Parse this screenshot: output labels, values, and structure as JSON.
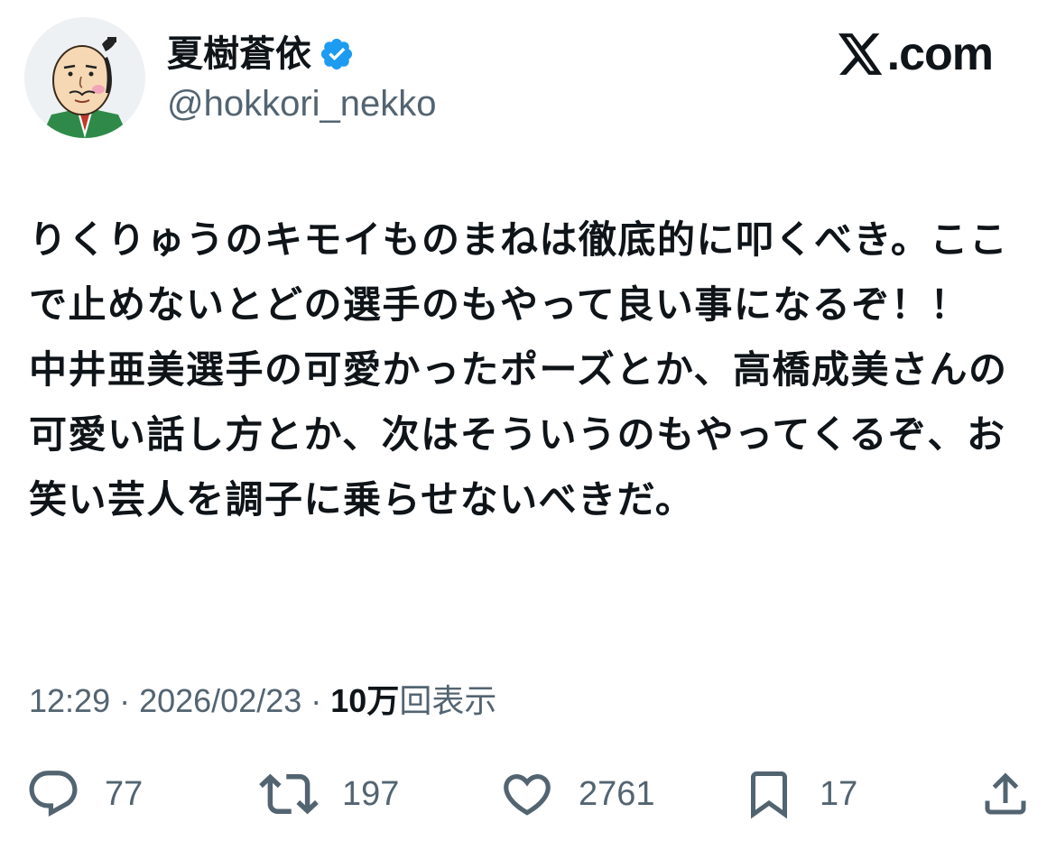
{
  "author": {
    "display_name": "夏樹蒼依",
    "handle": "@hokkori_nekko",
    "verified_icon": "verified-badge-icon",
    "verified_color": "#1d9bf0"
  },
  "brand": {
    "label": ".com",
    "icon": "x-logo-icon"
  },
  "tweet": {
    "text": "りくりゅうのキモイものまねは徹底的に叩くべき。ここで止めないとどの選手のもやって良い事になるぞ！！　中井亜美選手の可愛かったポーズとか、高橋成美さんの可愛い話し方とか、次はそういうのもやってくるぞ、お笑い芸人を調子に乗らせないべきだ。"
  },
  "meta": {
    "time": "12:29",
    "separator": " · ",
    "date": "2026/02/23",
    "views_count": "10万",
    "views_label": "回表示"
  },
  "actions": {
    "reply": {
      "icon": "reply-icon",
      "count": "77"
    },
    "repost": {
      "icon": "repost-icon",
      "count": "197"
    },
    "like": {
      "icon": "heart-icon",
      "count": "2761"
    },
    "bookmark": {
      "icon": "bookmark-icon",
      "count": "17"
    },
    "share": {
      "icon": "share-icon"
    }
  },
  "colors": {
    "text": "#0f1419",
    "secondary": "#536471",
    "accent": "#1d9bf0"
  }
}
